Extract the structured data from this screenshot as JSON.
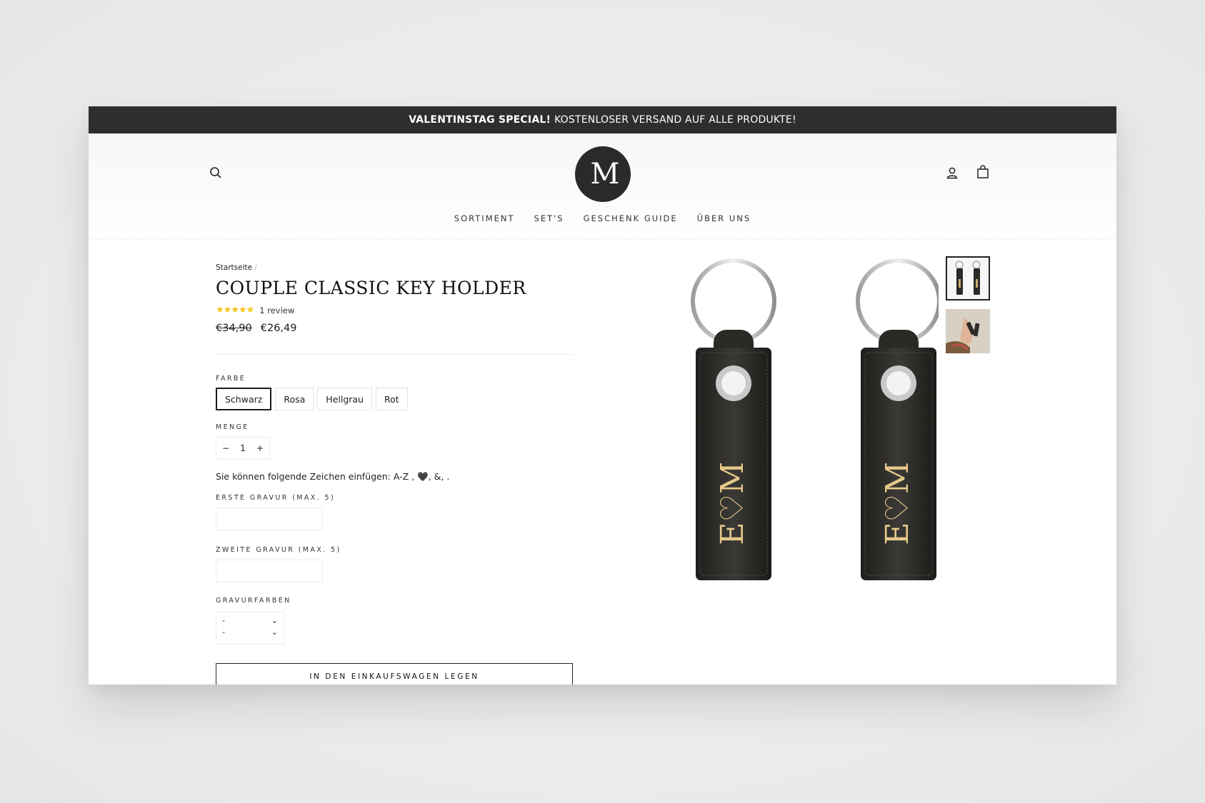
{
  "announcement": {
    "bold": "VALENTINSTAG SPECIAL!",
    "text": "KOSTENLOSER VERSAND AUF ALLE PRODUKTE!"
  },
  "header": {
    "logo_text": "M",
    "nav": [
      "SORTIMENT",
      "SET'S",
      "GESCHENK GUIDE",
      "ÜBER UNS"
    ],
    "icons": [
      "search-icon",
      "account-icon",
      "cart-icon"
    ]
  },
  "product": {
    "breadcrumb": "Startseite",
    "breadcrumb_sep": "/",
    "title": "COUPLE CLASSIC KEY HOLDER",
    "rating_stars": 5,
    "review_count": "1 review",
    "price_old": "€34,90",
    "price_new": "€26,49",
    "engraving": "E♡M",
    "colors": {
      "accent": "#1b1b1b",
      "star": "#f5c518",
      "leather": "#2b2a28",
      "gold": "#e6c98a"
    }
  },
  "options": {
    "color_label": "FARBE",
    "colors": [
      "Schwarz",
      "Rosa",
      "Hellgrau",
      "Rot"
    ],
    "selected_color": "Schwarz",
    "qty_label": "MENGE",
    "qty_minus": "−",
    "qty_value": "1",
    "qty_plus": "+",
    "hint": "Sie können folgende Zeichen einfügen: A-Z , 🖤, &, .",
    "first_label": "ERSTE GRAVUR (MAX. 5)",
    "first_value": "",
    "second_label": "ZWEITE GRAVUR (MAX. 5)",
    "second_value": "",
    "engrave_color_label": "GRAVURFARBEN",
    "engrave_color_values": [
      "-",
      "-"
    ]
  },
  "cart_button": "IN DEN EINKAUFSWAGEN LEGEN"
}
